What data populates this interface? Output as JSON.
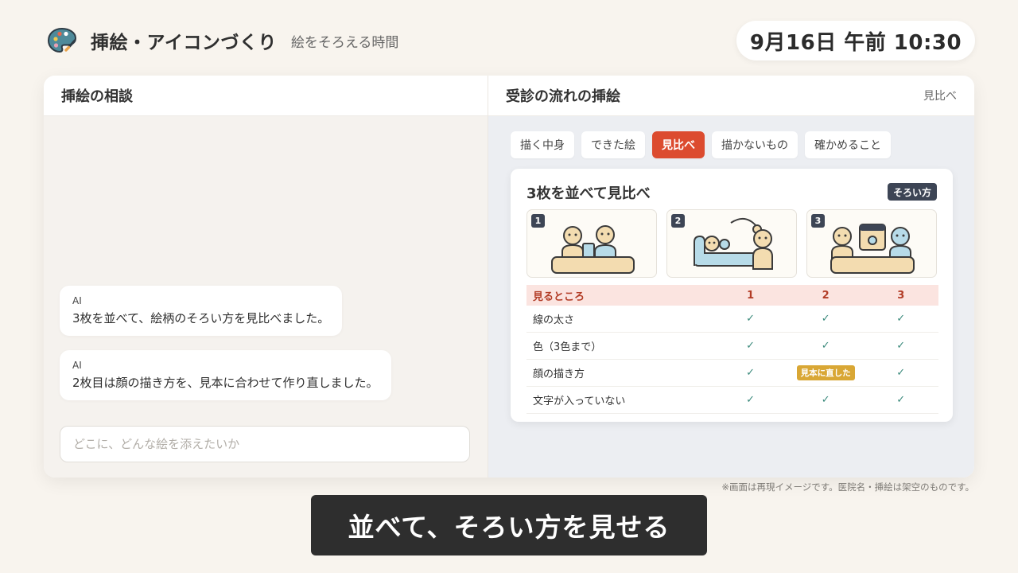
{
  "header": {
    "logo_icon": "palette-icon",
    "title": "挿絵・アイコンづくり",
    "subtitle": "絵をそろえる時間",
    "clock": "9月16日 午前 10:30"
  },
  "left_pane": {
    "title": "挿絵の相談",
    "messages": [
      {
        "sender": "AI",
        "text": "3枚を並べて、絵柄のそろい方を見比べました。"
      },
      {
        "sender": "AI",
        "text": "2枚目は顔の描き方を、見本に合わせて作り直しました。"
      }
    ],
    "input_placeholder": "どこに、どんな絵を添えたいか"
  },
  "right_pane": {
    "title": "受診の流れの挿絵",
    "header_link": "見比べ",
    "tabs": [
      {
        "label": "描く中身",
        "active": false
      },
      {
        "label": "できた絵",
        "active": false
      },
      {
        "label": "見比べ",
        "active": true
      },
      {
        "label": "描かないもの",
        "active": false
      },
      {
        "label": "確かめること",
        "active": false
      }
    ],
    "card": {
      "title": "3枚を並べて見比べ",
      "badge": "そろい方",
      "thumbnails": [
        {
          "number": "1",
          "illustration": "two-people-at-desk"
        },
        {
          "number": "2",
          "illustration": "patient-lying-with-doctor"
        },
        {
          "number": "3",
          "illustration": "people-with-monitor"
        }
      ],
      "table": {
        "headers": [
          "見るところ",
          "1",
          "2",
          "3"
        ],
        "rows": [
          {
            "label": "線の太さ",
            "cells": [
              "✓",
              "✓",
              "✓"
            ]
          },
          {
            "label": "色（3色まで）",
            "cells": [
              "✓",
              "✓",
              "✓"
            ]
          },
          {
            "label": "顔の描き方",
            "cells": [
              "✓",
              "見本に直した",
              "✓"
            ]
          },
          {
            "label": "文字が入っていない",
            "cells": [
              "✓",
              "✓",
              "✓"
            ]
          }
        ]
      }
    }
  },
  "disclaimer": "※画面は再現イメージです。医院名・挿絵は架空のものです。",
  "caption": "並べて、そろい方を見せる",
  "colors": {
    "accent": "#dc4b2f",
    "badge_dark": "#3d4555",
    "check": "#3b8a7c",
    "highlight": "#d9a735",
    "figure_skin": "#f3dcb0",
    "figure_blue": "#b7dbe8"
  }
}
